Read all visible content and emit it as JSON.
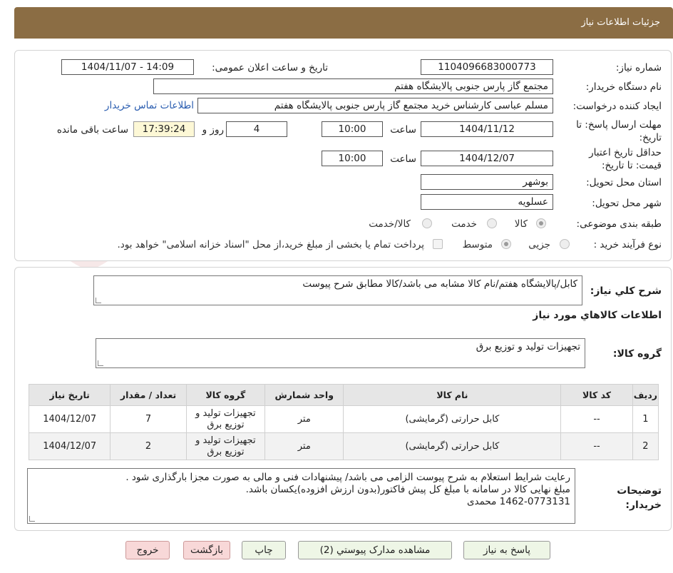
{
  "header": {
    "title": "جزئیات اطلاعات نیاز"
  },
  "form": {
    "need_number": {
      "label": "شماره نیاز:",
      "value": "1104096683000773"
    },
    "announce": {
      "label": "تاریخ و ساعت اعلان عمومی:",
      "value": "1404/11/07 - 14:09"
    },
    "buyer": {
      "label": "نام دستگاه خریدار:",
      "value": "مجتمع گاز پارس جنوبی  پالایشگاه هفتم"
    },
    "creator": {
      "label": "ایجاد کننده درخواست:",
      "value": "مسلم عباسی کارشناس خرید مجتمع گاز پارس جنوبی  پالایشگاه هفتم",
      "contact_link": "اطلاعات تماس خریدار"
    },
    "deadline": {
      "label": "مهلت ارسال پاسخ: تا تاریخ:",
      "date": "1404/11/12",
      "time_label": "ساعت",
      "time": "10:00",
      "days": "4",
      "days_label": "روز و",
      "remaining": "17:39:24",
      "remaining_label": "ساعت باقی مانده"
    },
    "validity": {
      "label": "حداقل تاریخ اعتبار قیمت: تا تاریخ:",
      "date": "1404/12/07",
      "time_label": "ساعت",
      "time": "10:00"
    },
    "province": {
      "label": "استان محل تحویل:",
      "value": "بوشهر"
    },
    "city": {
      "label": "شهر محل تحویل:",
      "value": "عسلویه"
    },
    "category": {
      "label": "طبقه بندی موضوعی:",
      "options": [
        "کالا",
        "خدمت",
        "کالا/خدمت"
      ],
      "selected": "کالا"
    },
    "process": {
      "label": "نوع فرآیند خرید :",
      "options": [
        "جزیی",
        "متوسط"
      ],
      "selected": "متوسط",
      "note": "پرداخت تمام یا بخشی از مبلغ خرید،از محل \"اسناد خزانه اسلامی\" خواهد بود."
    }
  },
  "summary": {
    "label": "شرح کلي نياز:",
    "value": "کابل/پالایشگاه هفتم/نام کالا مشابه می باشد/کالا مطابق شرح پیوست"
  },
  "goods": {
    "section_title": "اطلاعات کالاهاي مورد نياز",
    "group_label": "گروه کالا:",
    "group_value": "تجهیزات تولید و توزیع برق"
  },
  "table": {
    "headers": [
      "ردیف",
      "کد کالا",
      "نام کالا",
      "واحد شمارش",
      "گروه کالا",
      "تعداد / مقدار",
      "تاریخ نیاز"
    ],
    "rows": [
      [
        "1",
        "--",
        "کابل حرارتی (گرمایشی)",
        "متر",
        "تجهیزات تولید و توزیع برق",
        "7",
        "1404/12/07"
      ],
      [
        "2",
        "--",
        "کابل حرارتی (گرمایشی)",
        "متر",
        "تجهیزات تولید و توزیع برق",
        "2",
        "1404/12/07"
      ]
    ]
  },
  "notes": {
    "label": "توضیحات خریدار:",
    "lines": [
      "رعایت شرایط استعلام به شرح پیوست الزامی می باشد/ پیشنهادات فنی و مالی به صورت مجزا بارگذاری شود .",
      "مبلغ نهایی کالا در سامانه با مبلغ کل پیش فاکتور(بدون ارزش افزوده)یکسان باشد.",
      "1462-0773131 محمدی"
    ]
  },
  "buttons": {
    "respond": "پاسخ به نیاز",
    "docs": "مشاهده مدارک پیوستي (2)",
    "print": "چاپ",
    "back": "بازگشت",
    "exit": "خروج"
  },
  "watermark": {
    "text": "AriaTender.neT",
    "color": "#f0dede"
  },
  "colors": {
    "header_bg": "#8b6d44",
    "time_highlight": "#fdf8d6",
    "button_green": "#eef6e6",
    "button_red": "#f8d8d8",
    "link": "#2a5db0"
  }
}
